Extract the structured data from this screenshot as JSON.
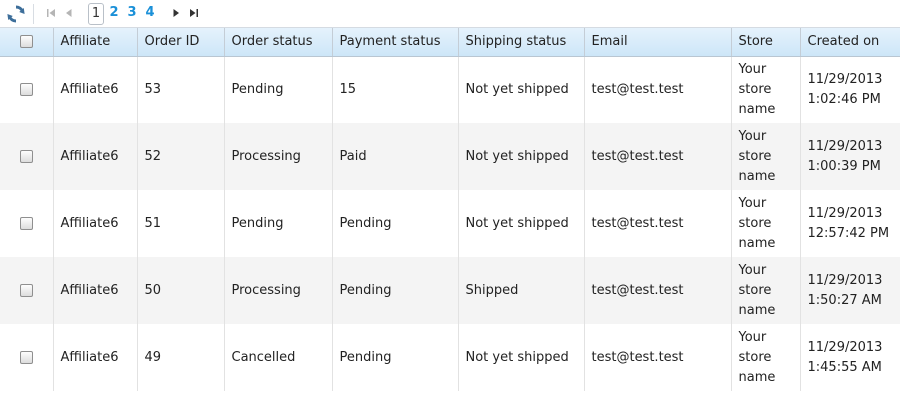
{
  "toolbar": {
    "pages": [
      "1",
      "2",
      "3",
      "4"
    ],
    "current_page": "1"
  },
  "columns": [
    "Affiliate",
    "Order ID",
    "Order status",
    "Payment status",
    "Shipping status",
    "Email",
    "Store",
    "Created on"
  ],
  "rows": [
    {
      "affiliate": "Affiliate6",
      "order_id": "53",
      "order_status": "Pending",
      "payment_status": "15",
      "shipping_status": "Not yet shipped",
      "email": "test@test.test",
      "store": [
        "Your",
        "store",
        "name"
      ],
      "created": [
        "11/29/2013",
        "1:02:46 PM"
      ]
    },
    {
      "affiliate": "Affiliate6",
      "order_id": "52",
      "order_status": "Processing",
      "payment_status": "Paid",
      "shipping_status": "Not yet shipped",
      "email": "test@test.test",
      "store": [
        "Your",
        "store",
        "name"
      ],
      "created": [
        "11/29/2013",
        "1:00:39 PM"
      ]
    },
    {
      "affiliate": "Affiliate6",
      "order_id": "51",
      "order_status": "Pending",
      "payment_status": "Pending",
      "shipping_status": "Not yet shipped",
      "email": "test@test.test",
      "store": [
        "Your",
        "store",
        "name"
      ],
      "created": [
        "11/29/2013",
        "12:57:42 PM"
      ]
    },
    {
      "affiliate": "Affiliate6",
      "order_id": "50",
      "order_status": "Processing",
      "payment_status": "Pending",
      "shipping_status": "Shipped",
      "email": "test@test.test",
      "store": [
        "Your",
        "store",
        "name"
      ],
      "created": [
        "11/29/2013",
        "1:50:27 AM"
      ]
    },
    {
      "affiliate": "Affiliate6",
      "order_id": "49",
      "order_status": "Cancelled",
      "payment_status": "Pending",
      "shipping_status": "Not yet shipped",
      "email": "test@test.test",
      "store": [
        "Your",
        "store",
        "name"
      ],
      "created": [
        "11/29/2013",
        "1:45:55 AM"
      ]
    }
  ],
  "icons": {
    "refresh": "refresh-icon",
    "first": "first-page-icon",
    "prev": "previous-page-icon",
    "next": "next-page-icon",
    "last": "last-page-icon"
  },
  "colors": {
    "header_gradient_top": "#e5f2fc",
    "header_gradient_bottom": "#cde6f8",
    "page_link": "#1a90d8",
    "alt_row": "#f4f4f4",
    "refresh_icon": "#3d6e9a"
  }
}
